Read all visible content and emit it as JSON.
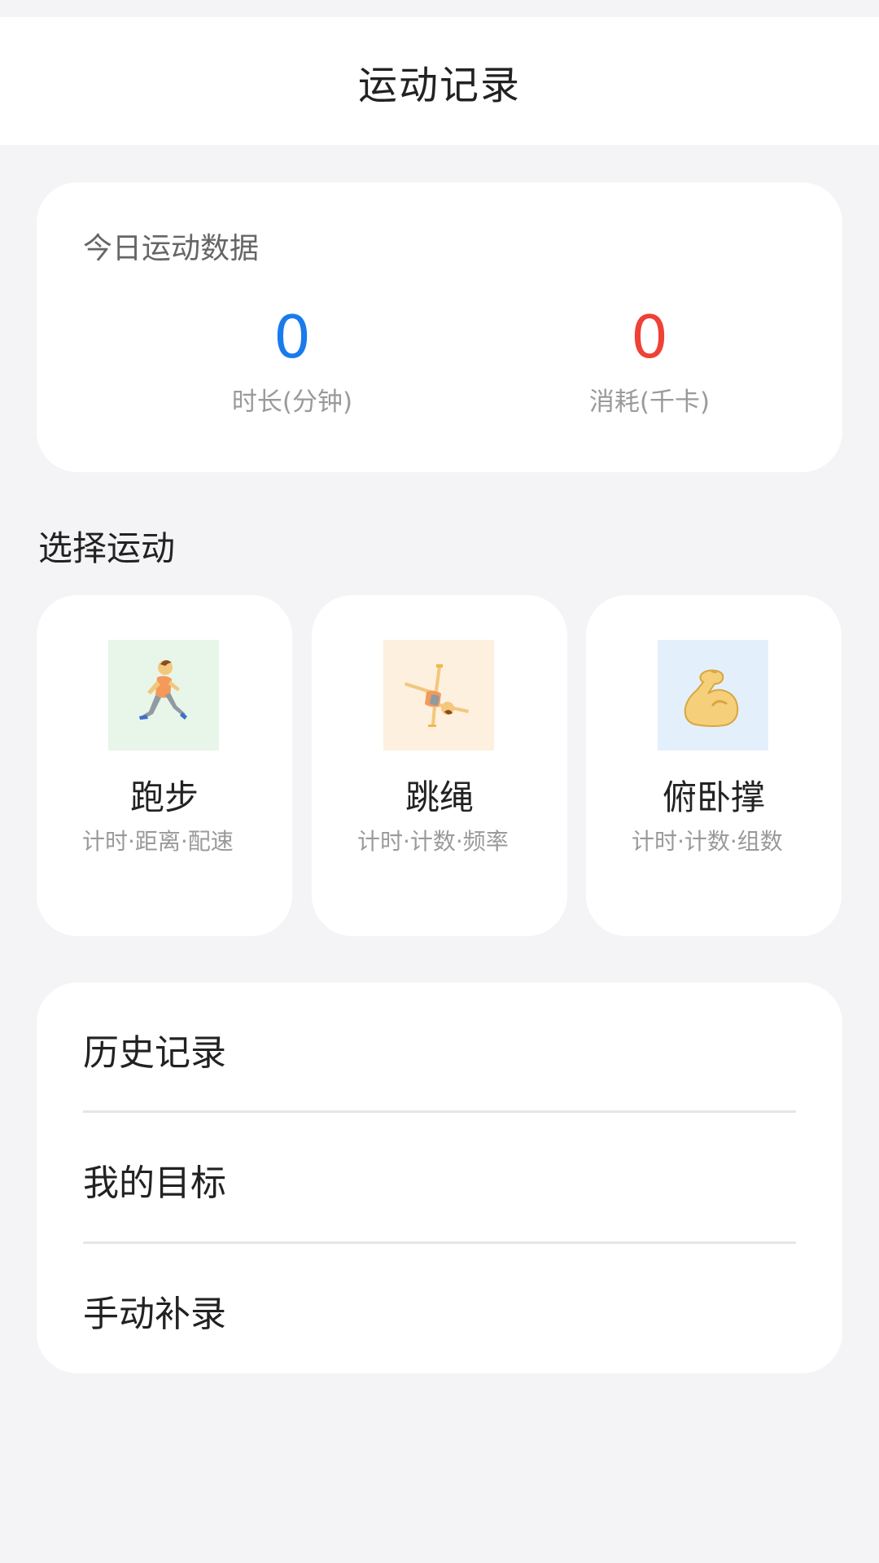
{
  "header": {
    "title": "运动记录"
  },
  "today": {
    "title": "今日运动数据",
    "duration": {
      "value": "0",
      "label": "时长(分钟)",
      "color": "#1a7bec"
    },
    "calories": {
      "value": "0",
      "label": "消耗(千卡)",
      "color": "#ef4136"
    }
  },
  "select_section": {
    "title": "选择运动"
  },
  "sports": [
    {
      "name": "跑步",
      "desc": "计时·距离·配速",
      "icon": "running-person-icon",
      "icon_bg": "#e8f5e9"
    },
    {
      "name": "跳绳",
      "desc": "计时·计数·频率",
      "icon": "cartwheel-person-icon",
      "icon_bg": "#fdf0df"
    },
    {
      "name": "俯卧撑",
      "desc": "计时·计数·组数",
      "icon": "flexed-biceps-icon",
      "icon_bg": "#e3f0fc"
    }
  ],
  "menu": [
    {
      "label": "历史记录"
    },
    {
      "label": "我的目标"
    },
    {
      "label": "手动补录"
    }
  ]
}
